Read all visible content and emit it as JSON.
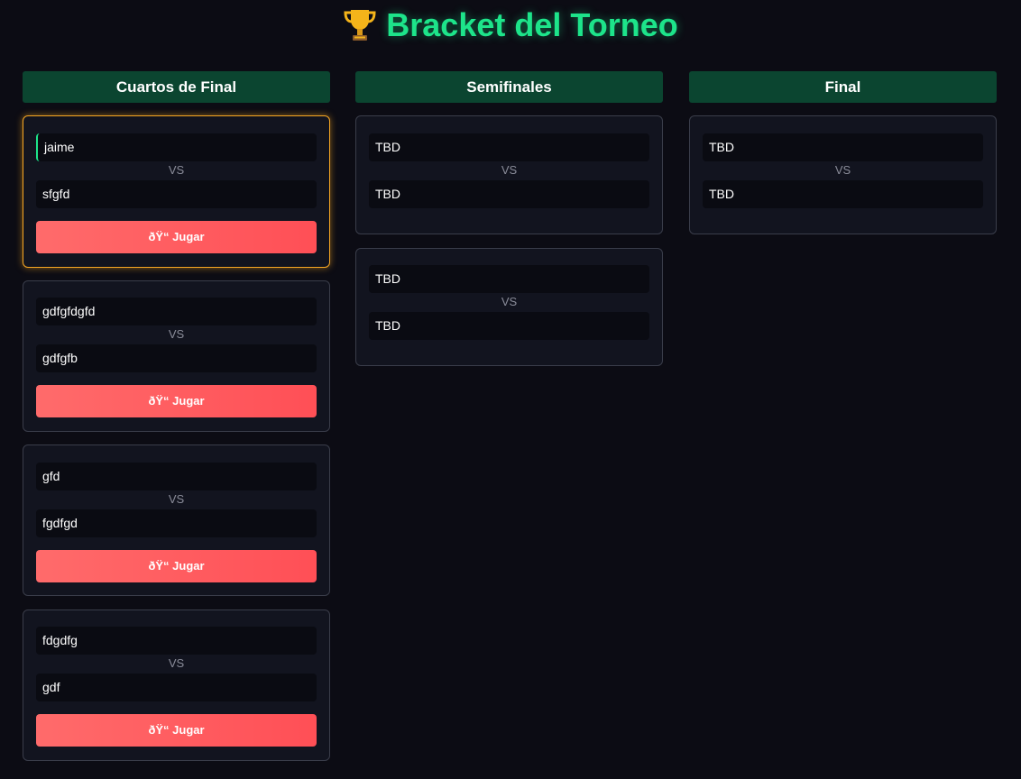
{
  "title": "Bracket del Torneo",
  "icons": {
    "trophy": "trophy-icon"
  },
  "colors": {
    "accent": "#1de48a",
    "header_bg": "#0b4530",
    "button": "#ff5a5f",
    "active_border": "#f5a623"
  },
  "rounds": [
    {
      "name": "Cuartos de Final",
      "matches": [
        {
          "p1": "jaime",
          "p2": "sfgfd",
          "vs": "VS",
          "button": "ðŸ“ Jugar"
        },
        {
          "p1": "gdfgfdgfd",
          "p2": "gdfgfb",
          "vs": "VS",
          "button": "ðŸ“ Jugar"
        },
        {
          "p1": "gfd",
          "p2": "fgdfgd",
          "vs": "VS",
          "button": "ðŸ“ Jugar"
        },
        {
          "p1": "fdgdfg",
          "p2": "gdf",
          "vs": "VS",
          "button": "ðŸ“ Jugar"
        }
      ]
    },
    {
      "name": "Semifinales",
      "matches": [
        {
          "p1": "TBD",
          "p2": "TBD",
          "vs": "VS"
        },
        {
          "p1": "TBD",
          "p2": "TBD",
          "vs": "VS"
        }
      ]
    },
    {
      "name": "Final",
      "matches": [
        {
          "p1": "TBD",
          "p2": "TBD",
          "vs": "VS"
        }
      ]
    }
  ]
}
